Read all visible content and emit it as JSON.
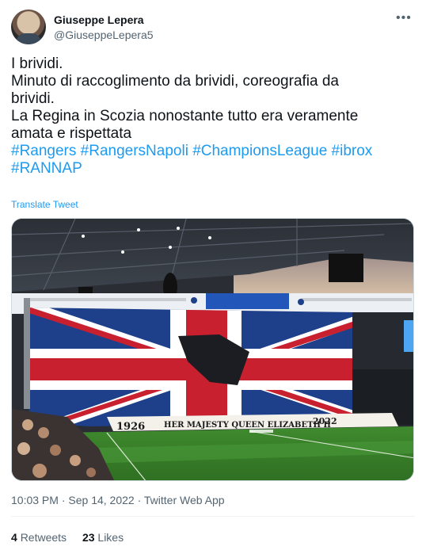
{
  "author": {
    "display_name": "Giuseppe Lepera",
    "handle": "@GiuseppeLepera5"
  },
  "tweet": {
    "lines": [
      "I brividi.",
      "Minuto di raccoglimento da brividi, coreografia da",
      "brividi.",
      "La Regina in Scozia nonostante tutto era veramente",
      "amata e rispettata"
    ],
    "hashtags_line1": "#Rangers #RangersNapoli #ChampionsLeague #ibrox",
    "hashtags_line2": "#RANNAP",
    "translate_label": "Translate Tweet"
  },
  "media": {
    "banner_year_left": "1926",
    "banner_text": "HER MAJESTY QUEEN ELIZABETH II",
    "banner_year_right": "2022"
  },
  "meta": {
    "time": "10:03 PM",
    "date": "Sep 14, 2022",
    "source": "Twitter Web App",
    "separator": "·"
  },
  "stats": {
    "retweets_count": "4",
    "retweets_label": "Retweets",
    "likes_count": "23",
    "likes_label": "Likes"
  },
  "icons": {
    "more": "more-horizontal-icon"
  },
  "colors": {
    "link": "#1d9bf0",
    "secondary_text": "#536471",
    "flag_blue": "#1e3f8a",
    "flag_red": "#c8202f",
    "pitch_green": "#3f8a2e"
  }
}
